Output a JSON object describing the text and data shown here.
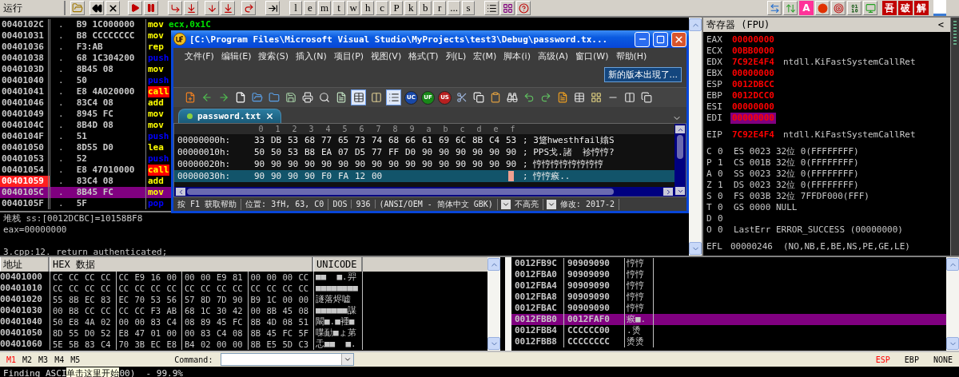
{
  "toolbar": {
    "mode": "运行",
    "letter_buttons": [
      "l",
      "e",
      "m",
      "t",
      "w",
      "h",
      "c",
      "P",
      "k",
      "b",
      "r",
      "...",
      "s"
    ],
    "plugin_buttons": [
      {
        "label": "A",
        "color": "#ff3399"
      },
      {
        "label": "吾",
        "color": "#c00000"
      },
      {
        "label": "破",
        "color": "#c00000"
      },
      {
        "label": "解",
        "color": "#c00000"
      }
    ]
  },
  "disassembly": {
    "rows": [
      {
        "address": "0040102C",
        "mark": ".",
        "bytes": "B9 1C000000",
        "mnemonic": "mov",
        "operands": "ecx,0x1C",
        "kind": "plain",
        "breakpoint": false,
        "selected": false
      },
      {
        "address": "00401031",
        "mark": ".",
        "bytes": "B8 CCCCCCCC",
        "mnemonic": "mov",
        "kind": "plain",
        "breakpoint": false,
        "selected": false
      },
      {
        "address": "00401036",
        "mark": ".",
        "bytes": "F3:AB",
        "mnemonic": "rep",
        "kind": "plain",
        "breakpoint": false,
        "selected": false
      },
      {
        "address": "00401038",
        "mark": ".",
        "bytes": "68 1C304200",
        "mnemonic": "push",
        "kind": "stack",
        "breakpoint": false,
        "selected": false
      },
      {
        "address": "0040103D",
        "mark": ".",
        "bytes": "8B45 08",
        "mnemonic": "mov",
        "kind": "plain",
        "breakpoint": false,
        "selected": false
      },
      {
        "address": "00401040",
        "mark": ".",
        "bytes": "50",
        "mnemonic": "push",
        "kind": "stack",
        "breakpoint": false,
        "selected": false
      },
      {
        "address": "00401041",
        "mark": ".",
        "bytes": "E8 4A020000",
        "mnemonic": "call",
        "kind": "call",
        "breakpoint": false,
        "selected": false
      },
      {
        "address": "00401046",
        "mark": ".",
        "bytes": "83C4 08",
        "mnemonic": "add",
        "kind": "plain",
        "breakpoint": false,
        "selected": false
      },
      {
        "address": "00401049",
        "mark": ".",
        "bytes": "8945 FC",
        "mnemonic": "mov",
        "kind": "plain",
        "breakpoint": false,
        "selected": false
      },
      {
        "address": "0040104C",
        "mark": ".",
        "bytes": "8B4D 08",
        "mnemonic": "mov",
        "kind": "plain",
        "breakpoint": false,
        "selected": false
      },
      {
        "address": "0040104F",
        "mark": ".",
        "bytes": "51",
        "mnemonic": "push",
        "kind": "stack",
        "breakpoint": false,
        "selected": false
      },
      {
        "address": "00401050",
        "mark": ".",
        "bytes": "8D55 D0",
        "mnemonic": "lea",
        "kind": "plain",
        "breakpoint": false,
        "selected": false
      },
      {
        "address": "00401053",
        "mark": ".",
        "bytes": "52",
        "mnemonic": "push",
        "kind": "stack",
        "breakpoint": false,
        "selected": false
      },
      {
        "address": "00401054",
        "mark": ".",
        "bytes": "E8 47010000",
        "mnemonic": "call",
        "kind": "call",
        "breakpoint": false,
        "selected": false
      },
      {
        "address": "00401059",
        "mark": ".",
        "bytes": "83C4 08",
        "mnemonic": "add",
        "kind": "plain",
        "breakpoint": true,
        "selected": false
      },
      {
        "address": "0040105C",
        "mark": ".",
        "bytes": "8B45 FC",
        "mnemonic": "mov",
        "kind": "plain",
        "breakpoint": false,
        "selected": true
      },
      {
        "address": "0040105F",
        "mark": ".",
        "bytes": "5F",
        "mnemonic": "pop",
        "kind": "stack",
        "breakpoint": false,
        "selected": false
      }
    ]
  },
  "info": {
    "lines": [
      "堆栈 ss:[0012DCBC]=10158BF8",
      "eax=00000000"
    ],
    "source": "3.cpp:12.  return authenticated;"
  },
  "registers": {
    "title": "寄存器 (FPU)",
    "collapse": "<",
    "general": [
      {
        "name": "EAX",
        "value": "00000000",
        "changed": true,
        "selected": false
      },
      {
        "name": "ECX",
        "value": "00BB0000",
        "changed": true,
        "selected": false
      },
      {
        "name": "EDX",
        "value": "7C92E4F4",
        "comment": "ntdll.KiFastSystemCallRet",
        "changed": true,
        "selected": false
      },
      {
        "name": "EBX",
        "value": "00000000",
        "changed": true,
        "selected": false
      },
      {
        "name": "ESP",
        "value": "0012DBCC",
        "changed": true,
        "selected": false
      },
      {
        "name": "EBP",
        "value": "0012DCC0",
        "changed": true,
        "selected": false
      },
      {
        "name": "ESI",
        "value": "00000000",
        "changed": true,
        "selected": false
      },
      {
        "name": "EDI",
        "value": "00000000",
        "changed": true,
        "selected": true
      }
    ],
    "eip": {
      "name": "EIP",
      "value": "7C92E4F4",
      "comment": "ntdll.KiFastSystemCallRet",
      "changed": true
    },
    "flags": [
      {
        "flag": "C",
        "value": "0",
        "segment": "ES 0023 32位 0(FFFFFFFF)"
      },
      {
        "flag": "P",
        "value": "1",
        "segment": "CS 001B 32位 0(FFFFFFFF)"
      },
      {
        "flag": "A",
        "value": "0",
        "segment": "SS 0023 32位 0(FFFFFFFF)"
      },
      {
        "flag": "Z",
        "value": "1",
        "segment": "DS 0023 32位 0(FFFFFFFF)"
      },
      {
        "flag": "S",
        "value": "0",
        "segment": "FS 003B 32位 7FFDF000(FFF)"
      },
      {
        "flag": "T",
        "value": "0",
        "segment": "GS 0000 NULL"
      },
      {
        "flag": "D",
        "value": "0"
      },
      {
        "flag": "O",
        "value": "0",
        "segment": "LastErr ERROR_SUCCESS (00000000)"
      }
    ],
    "efl": {
      "name": "EFL",
      "value": "00000246",
      "comment": "(NO,NB,E,BE,NS,PE,GE,LE)"
    }
  },
  "dump": {
    "columns": [
      "地址",
      "HEX 数据",
      "UNICODE"
    ],
    "rows": [
      {
        "address": "00401000",
        "hex": [
          "CC CC CC CC",
          "CC E9 16 00",
          "00 00 E9 81",
          "00 00 00 CC"
        ],
        "text": "■■  ■.羿"
      },
      {
        "address": "00401010",
        "hex": [
          "CC CC CC CC",
          "CC CC CC CC",
          "CC CC CC CC",
          "CC CC CC CC"
        ],
        "text": "■■■■■■■■"
      },
      {
        "address": "00401020",
        "hex": [
          "55 8B EC 83",
          "EC 70 53 56",
          "57 8D 7D 90",
          "B9 1C 00 00"
        ],
        "text": "譢落烬嘘"
      },
      {
        "address": "00401030",
        "hex": [
          "00 B8 CC CC",
          "CC CC F3 AB",
          "68 1C 30 42",
          "00 8B 45 08"
        ],
        "text": "■■■■■■謀"
      },
      {
        "address": "00401040",
        "hex": [
          "50 E8 4A 02",
          "00 00 83 C4",
          "08 89 45 FC",
          "8B 4D 08 51"
        ],
        "text": "闞■.■褈■"
      },
      {
        "address": "00401050",
        "hex": [
          "8D 55 D0 52",
          "E8 47 01 00",
          "00 83 C4 08",
          "8B 45 FC 5F"
        ],
        "text": "喋勔■ょ苐"
      },
      {
        "address": "00401060",
        "hex": [
          "5E 5B 83 C4",
          "70 3B EC E8",
          "B4 02 00 00",
          "8B E5 5D C3"
        ],
        "text": "忎■■  ■."
      }
    ]
  },
  "stack": {
    "rows": [
      {
        "address": "0012FB9C",
        "value": "90909090",
        "text": "悙悙",
        "selected": false
      },
      {
        "address": "0012FBA0",
        "value": "90909090",
        "text": "悙悙",
        "selected": false
      },
      {
        "address": "0012FBA4",
        "value": "90909090",
        "text": "悙悙",
        "selected": false
      },
      {
        "address": "0012FBA8",
        "value": "90909090",
        "text": "悙悙",
        "selected": false
      },
      {
        "address": "0012FBAC",
        "value": "90909090",
        "text": "悙悙",
        "selected": false
      },
      {
        "address": "0012FBB0",
        "value": "0012FAF0",
        "text": "瘊■.",
        "selected": true
      },
      {
        "address": "0012FBB4",
        "value": "CCCCCC00",
        "text": ".烫",
        "selected": false
      },
      {
        "address": "0012FBB8",
        "value": "CCCCCCCC",
        "text": "烫烫",
        "selected": false
      }
    ]
  },
  "command_bar": {
    "markers": [
      {
        "label": "M1",
        "selected": true
      },
      {
        "label": "M2",
        "selected": false
      },
      {
        "label": "M3",
        "selected": false
      },
      {
        "label": "M4",
        "selected": false
      },
      {
        "label": "M5",
        "selected": false
      }
    ],
    "command_label": "Command:",
    "bases": [
      {
        "label": "ESP",
        "selected": true
      },
      {
        "label": "EBP",
        "selected": false
      },
      {
        "label": "NONE",
        "selected": false
      }
    ]
  },
  "status_bar": {
    "before": "Finding ASCI",
    "tooltip": "单击这里开始",
    "after": "00)  - 99.9%"
  },
  "editor": {
    "title": "[C:\\Program Files\\Microsoft Visual Studio\\MyProjects\\test3\\Debug\\password.tx...",
    "menu": [
      "文件(F)",
      "编辑(E)",
      "搜索(S)",
      "插入(N)",
      "项目(P)",
      "视图(V)",
      "格式(T)",
      "列(L)",
      "宏(M)",
      "脚本(i)",
      "高级(A)",
      "窗口(W)",
      "帮助(H)"
    ],
    "notice": "新的版本出現了...",
    "badges": [
      {
        "label": "UC",
        "color": "#1848a8"
      },
      {
        "label": "UF",
        "color": "#188818"
      },
      {
        "label": "US",
        "color": "#b82020"
      }
    ],
    "tab": "password.txt",
    "ruler": [
      "0",
      "1",
      "2",
      "3",
      "4",
      "5",
      "6",
      "7",
      "8",
      "9",
      "a",
      "b",
      "c",
      "d",
      "e",
      "f"
    ],
    "rows": [
      {
        "offset": "00000000h:",
        "bytes": [
          "33",
          "DB",
          "53",
          "68",
          "77",
          "65",
          "73",
          "74",
          "68",
          "66",
          "61",
          "69",
          "6C",
          "8B",
          "C4",
          "53"
        ],
        "text": "; 3跾hwesthfail嬆S",
        "selected": false
      },
      {
        "offset": "00000010h:",
        "bytes": [
          "50",
          "50",
          "53",
          "B8",
          "EA",
          "07",
          "D5",
          "77",
          "FF",
          "D0",
          "90",
          "90",
          "90",
          "90",
          "90",
          "90"
        ],
        "text": "; PPS戈.諸  袗悙悙?",
        "selected": false
      },
      {
        "offset": "00000020h:",
        "bytes": [
          "90",
          "90",
          "90",
          "90",
          "90",
          "90",
          "90",
          "90",
          "90",
          "90",
          "90",
          "90",
          "90",
          "90",
          "90",
          "90"
        ],
        "text": "; 悙悙悙悙悙悙悙悙",
        "selected": false
      },
      {
        "offset": "00000030h:",
        "bytes": [
          "90",
          "90",
          "90",
          "90",
          "F0",
          "FA",
          "12",
          "00"
        ],
        "text": "; 悙悙瘊..",
        "selected": true
      }
    ],
    "status": [
      {
        "kind": "text",
        "label": "按 F1 获取帮助"
      },
      {
        "kind": "text",
        "label": "位置: 3fH, 63, C0"
      },
      {
        "kind": "text",
        "label": "DOS"
      },
      {
        "kind": "text",
        "label": "936"
      },
      {
        "kind": "text",
        "label": "(ANSI/OEM - 简体中文 GBK)"
      },
      {
        "kind": "dropdown",
        "label": "不高亮"
      },
      {
        "kind": "dropdown",
        "label": "修改: 2017-2"
      }
    ]
  }
}
